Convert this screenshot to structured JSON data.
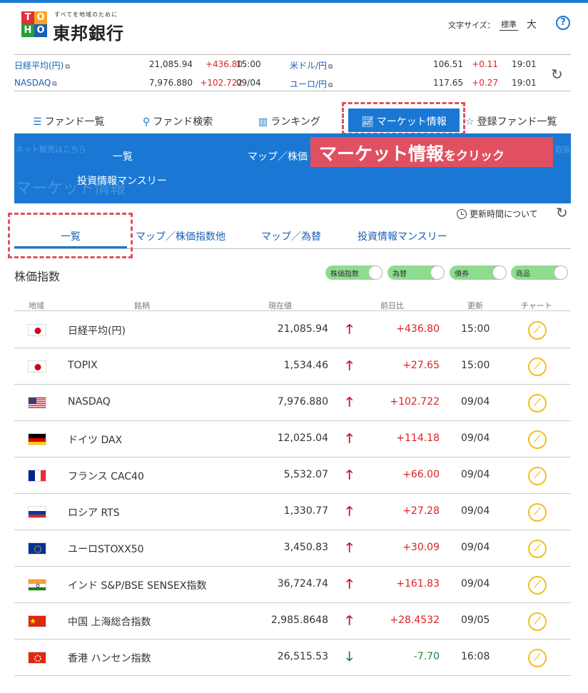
{
  "header": {
    "tagline": "すべてを地域のために",
    "bank_name": "東邦銀行",
    "font_size_label": "文字サイズ：",
    "font_size_standard": "標準",
    "font_size_large": "大",
    "help": "?"
  },
  "tickers": [
    {
      "name": "日経平均(円)",
      "value": "21,085.94",
      "change": "+436.80",
      "time": "15:00"
    },
    {
      "name": "NASDAQ",
      "value": "7,976.880",
      "change": "+102.722",
      "time": "09/04"
    },
    {
      "name": "米ドル/円",
      "value": "106.51",
      "change": "+0.11",
      "time": "19:01"
    },
    {
      "name": "ユーロ/円",
      "value": "117.65",
      "change": "+0.27",
      "time": "19:01"
    }
  ],
  "nav": {
    "fund_list": "ファンド一覧",
    "fund_search": "ファンド検索",
    "ranking": "ランキング",
    "market_info": "マーケット情報",
    "registered_funds": "登録ファンド一覧"
  },
  "dropdown": {
    "faint_left": "ネット販売はこちら",
    "faint_right": "取扱",
    "faint_title": "マーケット情報",
    "item_list": "一覧",
    "item_map_index": "マップ／株価",
    "item_monthly": "投資情報マンスリー"
  },
  "callout": {
    "main": "マーケット情報",
    "suffix": "をクリック"
  },
  "update_time_label": "更新時間について",
  "subtabs": [
    "一覧",
    "マップ／株価指数他",
    "マップ／為替",
    "投資情報マンスリー"
  ],
  "section": {
    "title": "株価指数",
    "toggles": [
      "株価指数",
      "為替",
      "債券",
      "商品"
    ]
  },
  "table": {
    "headers": {
      "region": "地域",
      "name": "銘柄",
      "price": "現在値",
      "change": "前日比",
      "updated": "更新",
      "chart": "チャート"
    },
    "rows": [
      {
        "flag": "japan-flag",
        "name": "日経平均(円)",
        "price": "21,085.94",
        "dir": "up",
        "change": "+436.80",
        "updated": "15:00"
      },
      {
        "flag": "japan-flag",
        "name": "TOPIX",
        "price": "1,534.46",
        "dir": "up",
        "change": "+27.65",
        "updated": "15:00"
      },
      {
        "flag": "usa-flag",
        "name": "NASDAQ",
        "price": "7,976.880",
        "dir": "up",
        "change": "+102.722",
        "updated": "09/04"
      },
      {
        "flag": "germany-flag",
        "name": "ドイツ DAX",
        "price": "12,025.04",
        "dir": "up",
        "change": "+114.18",
        "updated": "09/04"
      },
      {
        "flag": "france-flag",
        "name": "フランス CAC40",
        "price": "5,532.07",
        "dir": "up",
        "change": "+66.00",
        "updated": "09/04"
      },
      {
        "flag": "russia-flag",
        "name": "ロシア RTS",
        "price": "1,330.77",
        "dir": "up",
        "change": "+27.28",
        "updated": "09/04"
      },
      {
        "flag": "eu-flag",
        "name": "ユーロSTOXX50",
        "price": "3,450.83",
        "dir": "up",
        "change": "+30.09",
        "updated": "09/04"
      },
      {
        "flag": "india-flag",
        "name": "インド S&P/BSE SENSEX指数",
        "price": "36,724.74",
        "dir": "up",
        "change": "+161.83",
        "updated": "09/04"
      },
      {
        "flag": "china-flag",
        "name": "中国 上海総合指数",
        "price": "2,985.8648",
        "dir": "up",
        "change": "+28.4532",
        "updated": "09/05"
      },
      {
        "flag": "hongkong-flag",
        "name": "香港 ハンセン指数",
        "price": "26,515.53",
        "dir": "down",
        "change": "-7.70",
        "updated": "16:08"
      }
    ]
  }
}
